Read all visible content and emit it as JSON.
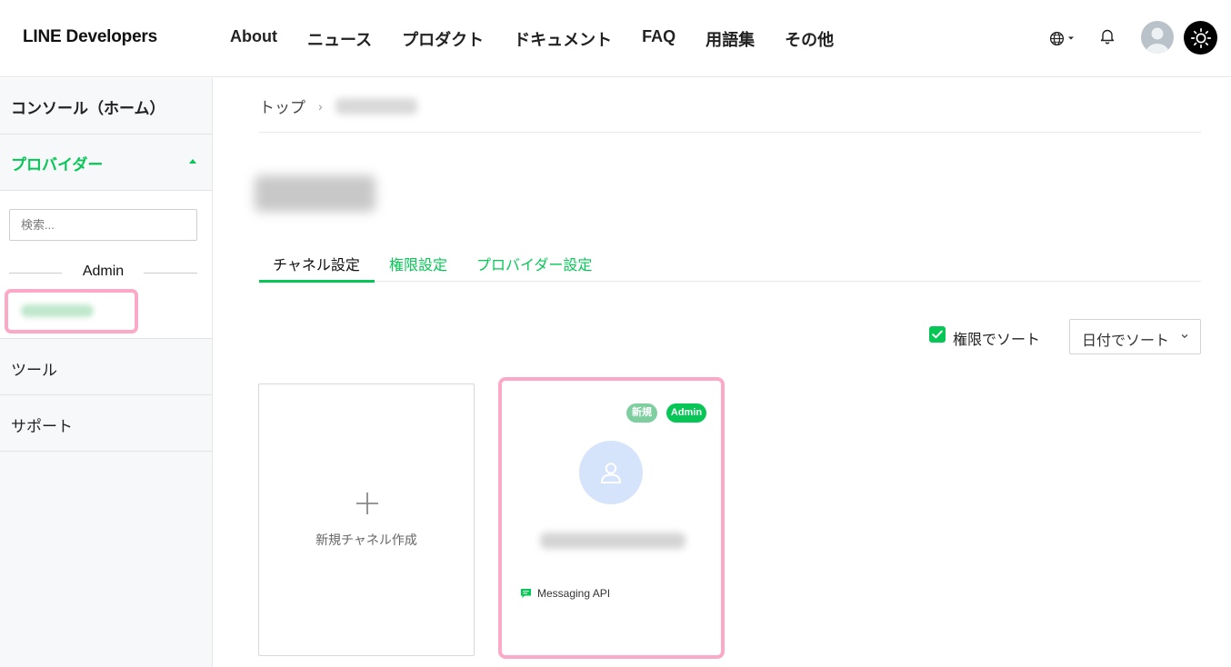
{
  "header": {
    "logo": "LINE Developers",
    "nav": [
      "About",
      "ニュース",
      "プロダクト",
      "ドキュメント",
      "FAQ",
      "用語集",
      "その他"
    ]
  },
  "sidebar": {
    "home": "コンソール（ホーム）",
    "providers": "プロバイダー",
    "search_placeholder": "検索...",
    "role_divider": "Admin",
    "tools": "ツール",
    "support": "サポート"
  },
  "breadcrumb": {
    "top": "トップ",
    "separator": "›"
  },
  "tabs": [
    "チャネル設定",
    "権限設定",
    "プロバイダー設定"
  ],
  "sort": {
    "checkbox_label": "権限でソート",
    "checked": true,
    "select_label": "日付でソート"
  },
  "cards": {
    "new_channel_label": "新規チャネル作成",
    "channel": {
      "badge_new": "新規",
      "badge_role": "Admin",
      "type": "Messaging API"
    }
  },
  "colors": {
    "brand_green": "#06c755",
    "highlight_pink": "#fba9c7",
    "avatar_bg": "#d6e4fb"
  }
}
